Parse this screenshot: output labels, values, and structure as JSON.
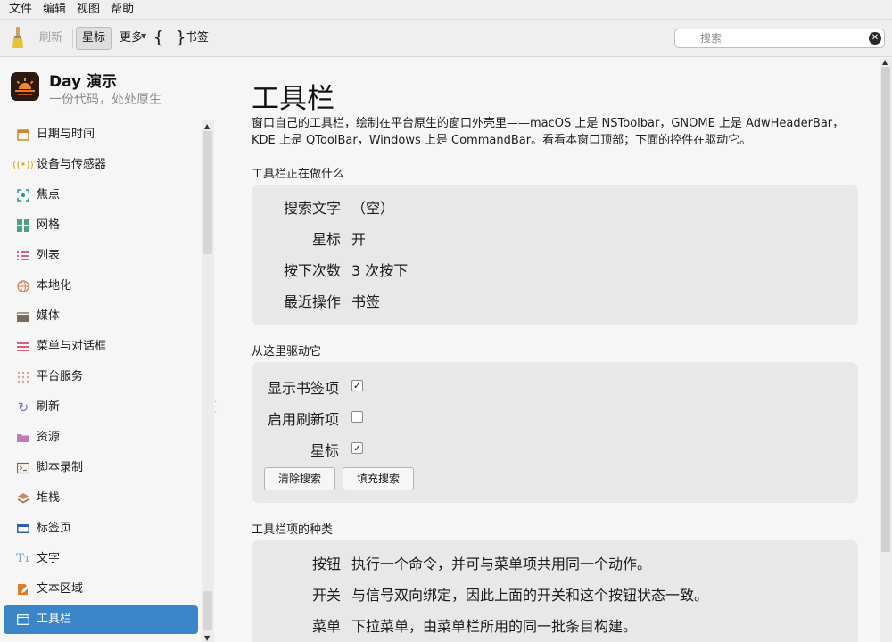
{
  "menubar": {
    "items": [
      "文件",
      "编辑",
      "视图",
      "帮助"
    ]
  },
  "toolbar": {
    "refresh_label": "刷新",
    "star_label": "星标",
    "more_label": "更多",
    "braces_label": "{ }",
    "bookmark_label": "书签",
    "search_placeholder": "搜索",
    "clear_glyph": "✕"
  },
  "sidebar": {
    "app_title": "Day 演示",
    "app_subtitle": "一份代码，处处原生",
    "items": [
      {
        "label": "日期与时间",
        "icon": "calendar-icon",
        "color": "#c98a2b"
      },
      {
        "label": "设备与传感器",
        "icon": "sensor-icon",
        "color": "#d6a81e"
      },
      {
        "label": "焦点",
        "icon": "focus-icon",
        "color": "#2f8f8a"
      },
      {
        "label": "网格",
        "icon": "grid-icon",
        "color": "#4f9e86"
      },
      {
        "label": "列表",
        "icon": "list-icon",
        "color": "#d9607a"
      },
      {
        "label": "本地化",
        "icon": "globe-icon",
        "color": "#e07b54"
      },
      {
        "label": "媒体",
        "icon": "clapperboard-icon",
        "color": "#7b6b5a"
      },
      {
        "label": "菜单与对话框",
        "icon": "menu-icon",
        "color": "#d9607a"
      },
      {
        "label": "平台服务",
        "icon": "dots-grid-icon",
        "color": "#e0a0a8"
      },
      {
        "label": "刷新",
        "icon": "refresh-icon",
        "color": "#8a6fb8"
      },
      {
        "label": "资源",
        "icon": "folder-icon",
        "color": "#c37ab0"
      },
      {
        "label": "脚本录制",
        "icon": "terminal-icon",
        "color": "#8a6040"
      },
      {
        "label": "堆栈",
        "icon": "stack-icon",
        "color": "#c98a6a"
      },
      {
        "label": "标签页",
        "icon": "tabs-icon",
        "color": "#2f5fa8"
      },
      {
        "label": "文字",
        "icon": "text-icon",
        "color": "#7aa0c8"
      },
      {
        "label": "文本区域",
        "icon": "edit-icon",
        "color": "#e07b2a"
      },
      {
        "label": "工具栏",
        "icon": "window-icon",
        "color": "#ffffff",
        "active": true
      }
    ]
  },
  "main": {
    "title": "工具栏",
    "description": "窗口自己的工具栏，绘制在平台原生的窗口外壳里——macOS 上是 NSToolbar，GNOME 上是 AdwHeaderBar，KDE 上是 QToolBar，Windows 上是 CommandBar。看看本窗口顶部；下面的控件在驱动它。",
    "status_header": "工具栏正在做什么",
    "status": [
      {
        "key": "搜索文字",
        "value": "（空）"
      },
      {
        "key": "星标",
        "value": "开"
      },
      {
        "key": "按下次数",
        "value": "3 次按下"
      },
      {
        "key": "最近操作",
        "value": "书签"
      }
    ],
    "drive_header": "从这里驱动它",
    "options": [
      {
        "label": "显示书签项",
        "checked": true
      },
      {
        "label": "启用刷新项",
        "checked": false
      },
      {
        "label": "星标",
        "checked": true
      }
    ],
    "clear_search_label": "清除搜索",
    "fill_search_label": "填充搜索",
    "kinds_header": "工具栏项的种类",
    "kinds": [
      {
        "key": "按钮",
        "value": "执行一个命令，并可与菜单项共用同一个动作。"
      },
      {
        "key": "开关",
        "value": "与信号双向绑定，因此上面的开关和这个按钮状态一致。"
      },
      {
        "key": "菜单",
        "value": "下拉菜单，由菜单栏所用的同一批条目构建。"
      }
    ]
  }
}
